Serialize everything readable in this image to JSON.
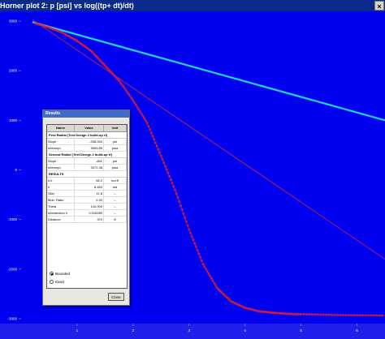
{
  "window": {
    "title": "Horner plot 2: p [psi] vs log((tp+ dt)/dt)",
    "close_label": "×"
  },
  "results_dialog": {
    "title": "Results",
    "columns": [
      "Name",
      "Value",
      "Unit"
    ],
    "sections": [
      {
        "heading": "First Radial (Test Design 2 build-up rf)",
        "rows": [
          [
            "Slope",
            "-338.334",
            "psi"
          ],
          [
            "Intercept",
            "3050.85",
            "psia"
          ]
        ]
      },
      {
        "heading": "Second Radial (Test Design 2 build-up rf)",
        "rows": [
          [
            "Slope",
            "-842",
            "psi"
          ],
          [
            "Intercept",
            "3471.48",
            "psia"
          ]
        ]
      },
      {
        "heading": "RESULTS",
        "rows": [
          [
            "k.h",
            "68.2",
            "md.ft"
          ],
          [
            "k",
            "8.463",
            "md"
          ],
          [
            "Skin",
            "11.8",
            "--"
          ],
          [
            "Mob. Ratio",
            "2.49",
            "--"
          ],
          [
            "Theta",
            "144.000",
            "--"
          ],
          [
            "Intersection X",
            "0.016289",
            "--"
          ],
          [
            "Distance",
            "370",
            "ft"
          ]
        ]
      }
    ],
    "options": [
      {
        "label": "Bounded",
        "selected": true
      },
      {
        "label": "Exact",
        "selected": false
      }
    ],
    "close_label": "Close"
  },
  "chart_data": {
    "type": "scatter",
    "title": "Horner plot 2: p [psi] vs log((tp+ dt)/dt)",
    "xlabel": "",
    "ylabel": "",
    "xlim": [
      0,
      6.5
    ],
    "ylim": [
      -3000,
      3000
    ],
    "x_ticks": [
      "1",
      "2",
      "3",
      "4",
      "5",
      "6"
    ],
    "y_ticks": [
      "3000",
      "2000",
      "1000",
      "0",
      "-1000",
      "-2000",
      "-3000"
    ],
    "series": [
      {
        "type": "points",
        "x": [
          0.25,
          0.5,
          0.75,
          1.0,
          1.25,
          1.5,
          1.75,
          2.0,
          2.25,
          2.5,
          2.75,
          3.0,
          3.25,
          3.5,
          3.75,
          4.0,
          4.25,
          4.5,
          4.75,
          5.0,
          5.5,
          6.0,
          6.5
        ],
        "y": [
          2960,
          2870,
          2760,
          2600,
          2400,
          2100,
          1800,
          1400,
          950,
          280,
          -400,
          -1200,
          -1900,
          -2380,
          -2650,
          -2780,
          -2850,
          -2880,
          -2900,
          -2910,
          -2920,
          -2930,
          -2935
        ]
      },
      {
        "type": "line",
        "x": [
          0.2,
          6.5
        ],
        "y": [
          2980,
          1000
        ]
      },
      {
        "type": "line",
        "x": [
          0.2,
          6.5
        ],
        "y": [
          3030,
          -1800
        ]
      }
    ],
    "colors": {
      "background": "#0000f0",
      "points": "#e8202a",
      "line_cyan": "#19d7e8",
      "line_red": "#e0282f",
      "axis_text": "#ffffff"
    }
  }
}
